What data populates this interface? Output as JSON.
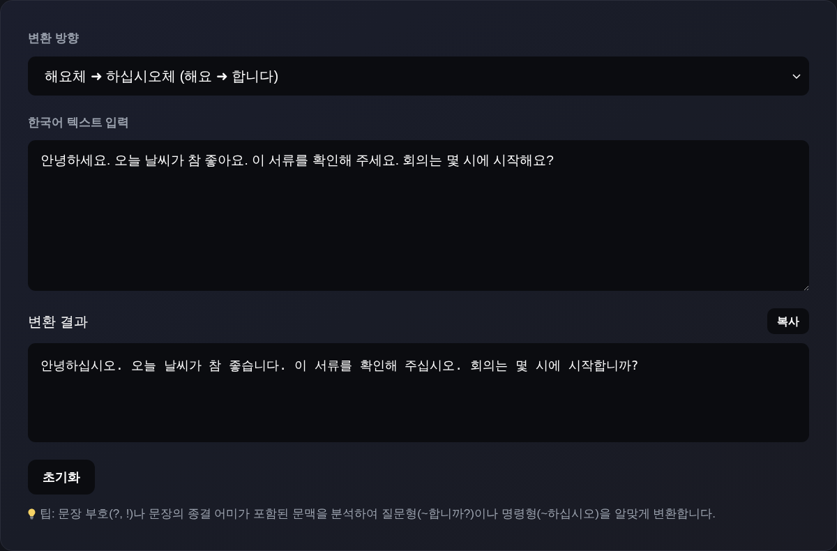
{
  "direction": {
    "label": "변환 방향",
    "select": {
      "value": "해요체 ➜ 하십시오체 (해요 ➜ 합니다)"
    }
  },
  "input": {
    "label": "한국어 텍스트 입력",
    "value": "안녕하세요. 오늘 날씨가 참 좋아요. 이 서류를 확인해 주세요. 회의는 몇 시에 시작해요?"
  },
  "result": {
    "title": "변환 결과",
    "copy_button": "복사",
    "text": "안녕하십시오. 오늘 날씨가 참 좋습니다. 이 서류를 확인해 주십시오. 회의는 몇 시에 시작합니까?"
  },
  "reset_button": "초기화",
  "tip": "팁: 문장 부호(?, !)나 문장의 종결 어미가 포함된 문맥을 분석하여 질문형(~합니까?)이나 명령형(~하십시오)을 알맞게 변환합니다."
}
